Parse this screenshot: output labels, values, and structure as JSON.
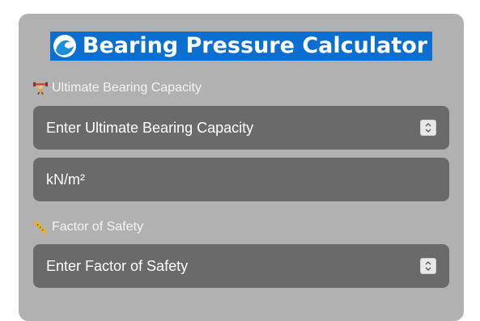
{
  "title": "Bearing Pressure Calculator",
  "fields": {
    "ultimate": {
      "label": "Ultimate Bearing Capacity",
      "placeholder": "Enter Ultimate Bearing Capacity"
    },
    "unit": {
      "value": "kN/m²"
    },
    "safety": {
      "label": "Factor of Safety",
      "placeholder": "Enter Factor of Safety"
    }
  },
  "icons": {
    "title": "wave-icon",
    "ultimate": "weight-lifter-icon",
    "safety": "ruler-icon",
    "spinner": "spin-arrows-icon"
  },
  "colors": {
    "card": "#b1b1b1",
    "title_bg": "#0a6fd1",
    "field_bg": "#6a6a6a"
  }
}
